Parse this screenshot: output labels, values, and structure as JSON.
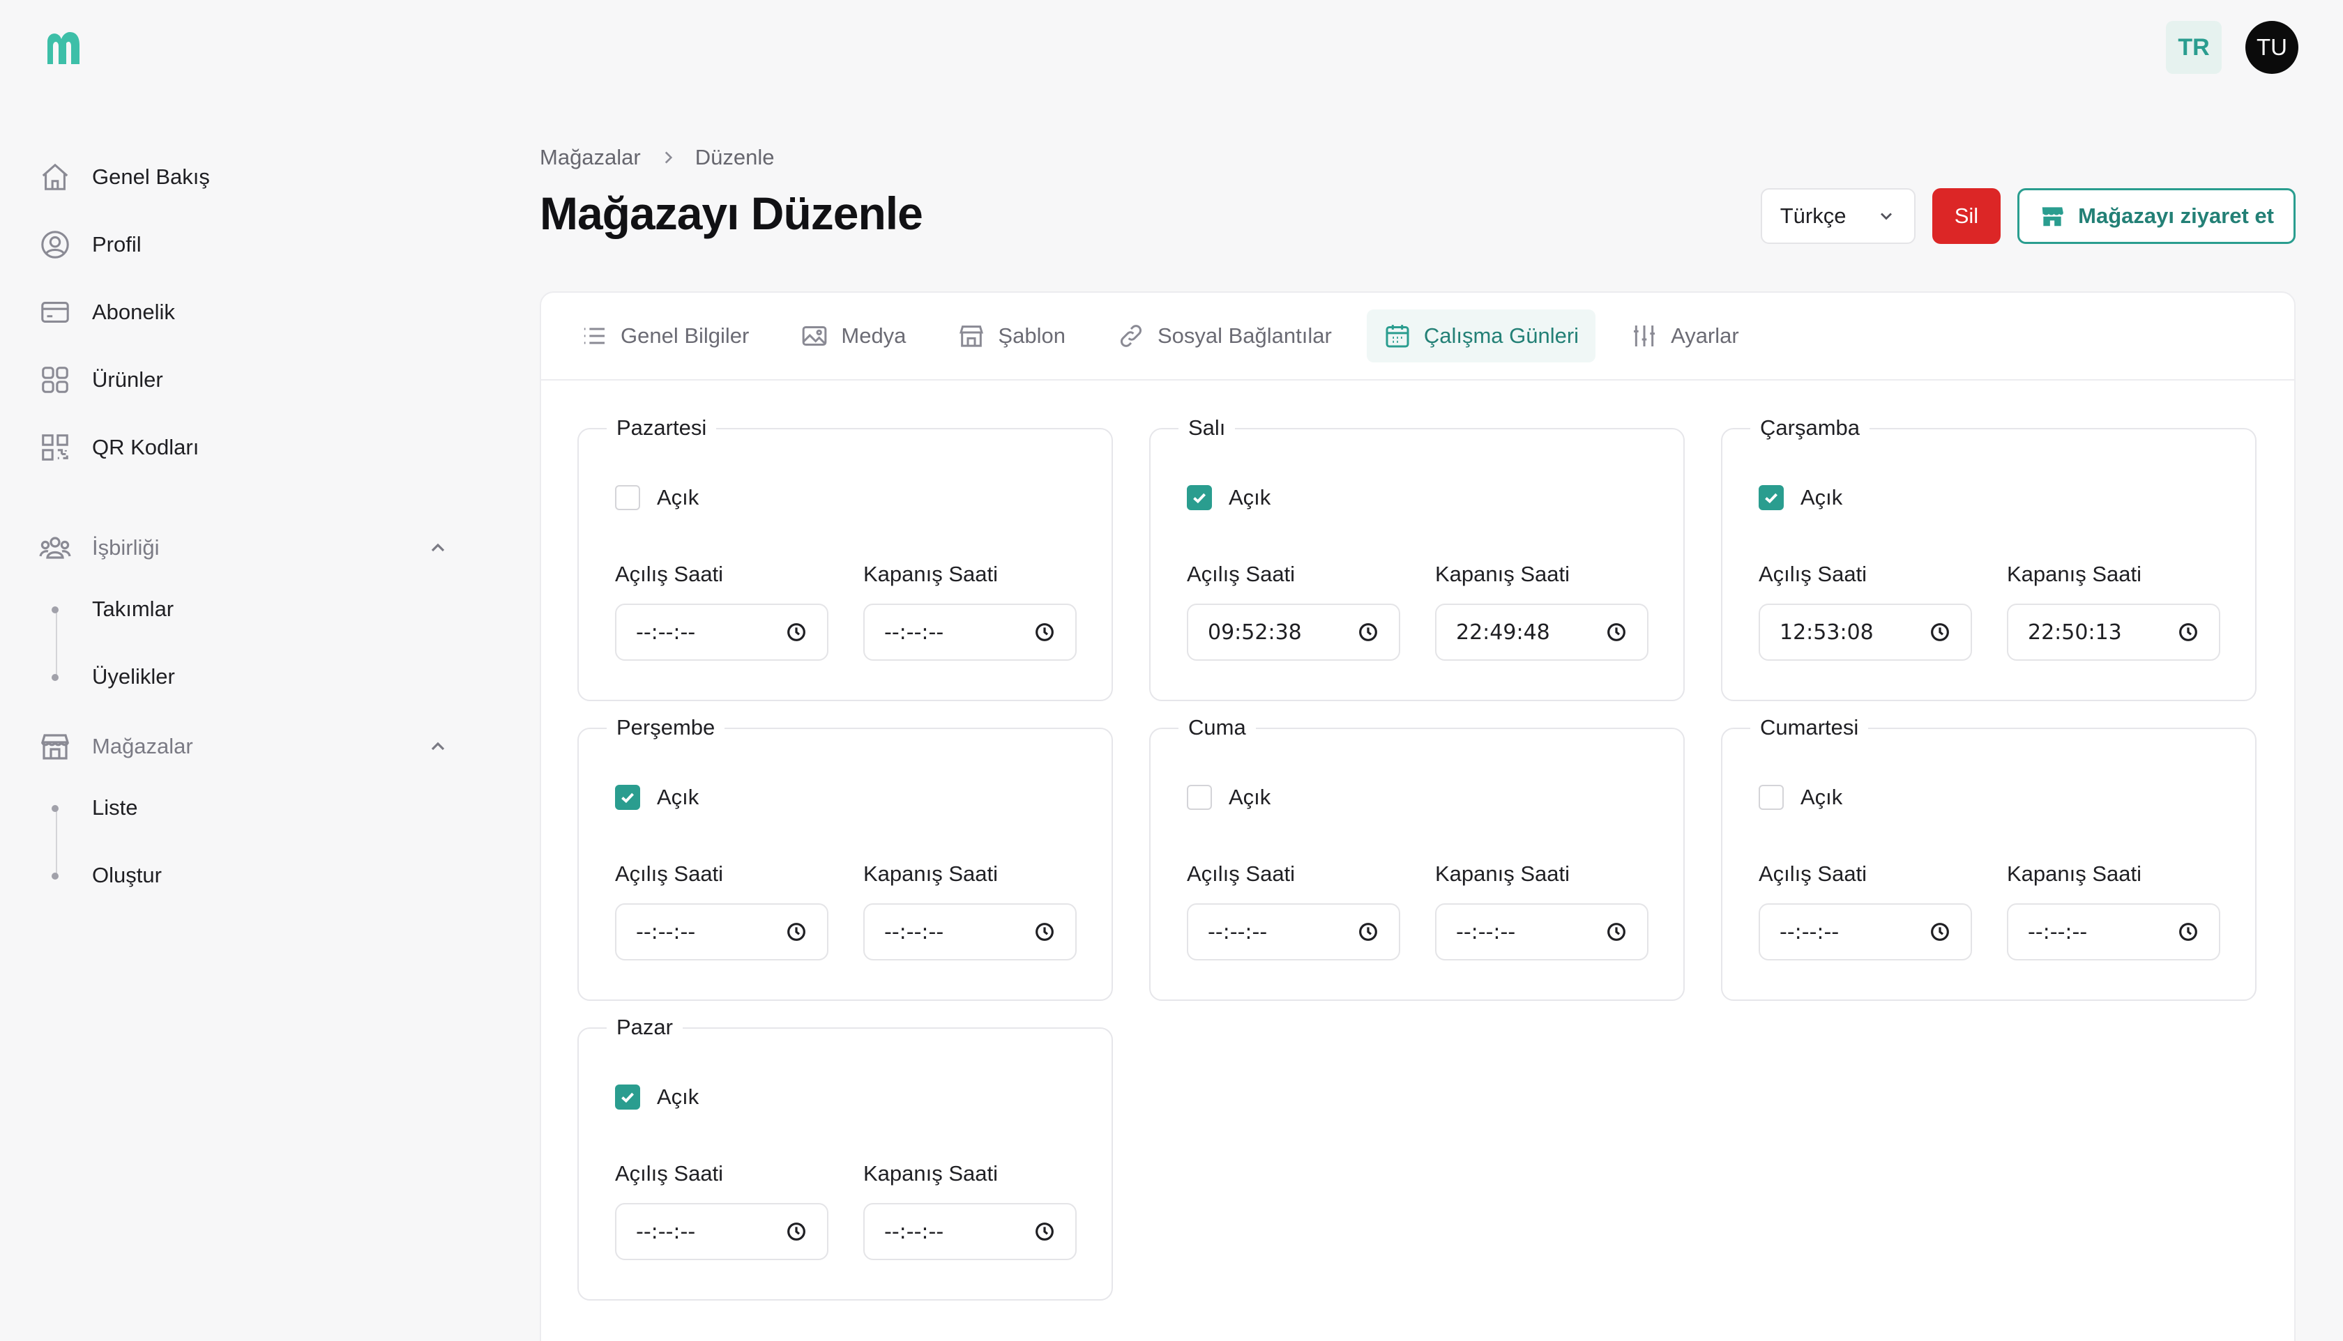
{
  "header": {
    "lang_badge": "TR",
    "avatar_initials": "TU"
  },
  "sidebar": {
    "items": [
      {
        "label": "Genel Bakış",
        "icon": "home-icon"
      },
      {
        "label": "Profil",
        "icon": "user-circle-icon"
      },
      {
        "label": "Abonelik",
        "icon": "credit-card-icon"
      },
      {
        "label": "Ürünler",
        "icon": "grid-icon"
      },
      {
        "label": "QR Kodları",
        "icon": "qr-code-icon"
      }
    ],
    "collab": {
      "label": "İşbirliği",
      "items": [
        "Takımlar",
        "Üyelikler"
      ]
    },
    "stores": {
      "label": "Mağazalar",
      "items": [
        "Liste",
        "Oluştur"
      ]
    }
  },
  "breadcrumb": {
    "root": "Mağazalar",
    "current": "Düzenle"
  },
  "page_title": "Mağazayı Düzenle",
  "actions": {
    "language": "Türkçe",
    "delete": "Sil",
    "visit": "Mağazayı ziyaret et"
  },
  "tabs": [
    {
      "label": "Genel Bilgiler",
      "icon": "list-icon"
    },
    {
      "label": "Medya",
      "icon": "image-icon"
    },
    {
      "label": "Şablon",
      "icon": "store-icon"
    },
    {
      "label": "Sosyal Bağlantılar",
      "icon": "link-icon"
    },
    {
      "label": "Çalışma Günleri",
      "icon": "calendar-icon",
      "active": true
    },
    {
      "label": "Ayarlar",
      "icon": "sliders-icon"
    }
  ],
  "labels": {
    "open": "Açık",
    "opening": "Açılış Saati",
    "closing": "Kapanış Saati"
  },
  "days": [
    {
      "name": "Pazartesi",
      "open": false,
      "opening": "--:--:--",
      "closing": "--:--:--"
    },
    {
      "name": "Salı",
      "open": true,
      "opening": "09:52:38",
      "closing": "22:49:48"
    },
    {
      "name": "Çarşamba",
      "open": true,
      "opening": "12:53:08",
      "closing": "22:50:13"
    },
    {
      "name": "Perşembe",
      "open": true,
      "opening": "--:--:--",
      "closing": "--:--:--"
    },
    {
      "name": "Cuma",
      "open": false,
      "opening": "--:--:--",
      "closing": "--:--:--"
    },
    {
      "name": "Cumartesi",
      "open": false,
      "opening": "--:--:--",
      "closing": "--:--:--"
    },
    {
      "name": "Pazar",
      "open": true,
      "opening": "--:--:--",
      "closing": "--:--:--"
    }
  ],
  "colors": {
    "accent": "#2a9d8f",
    "danger": "#dc2626"
  }
}
